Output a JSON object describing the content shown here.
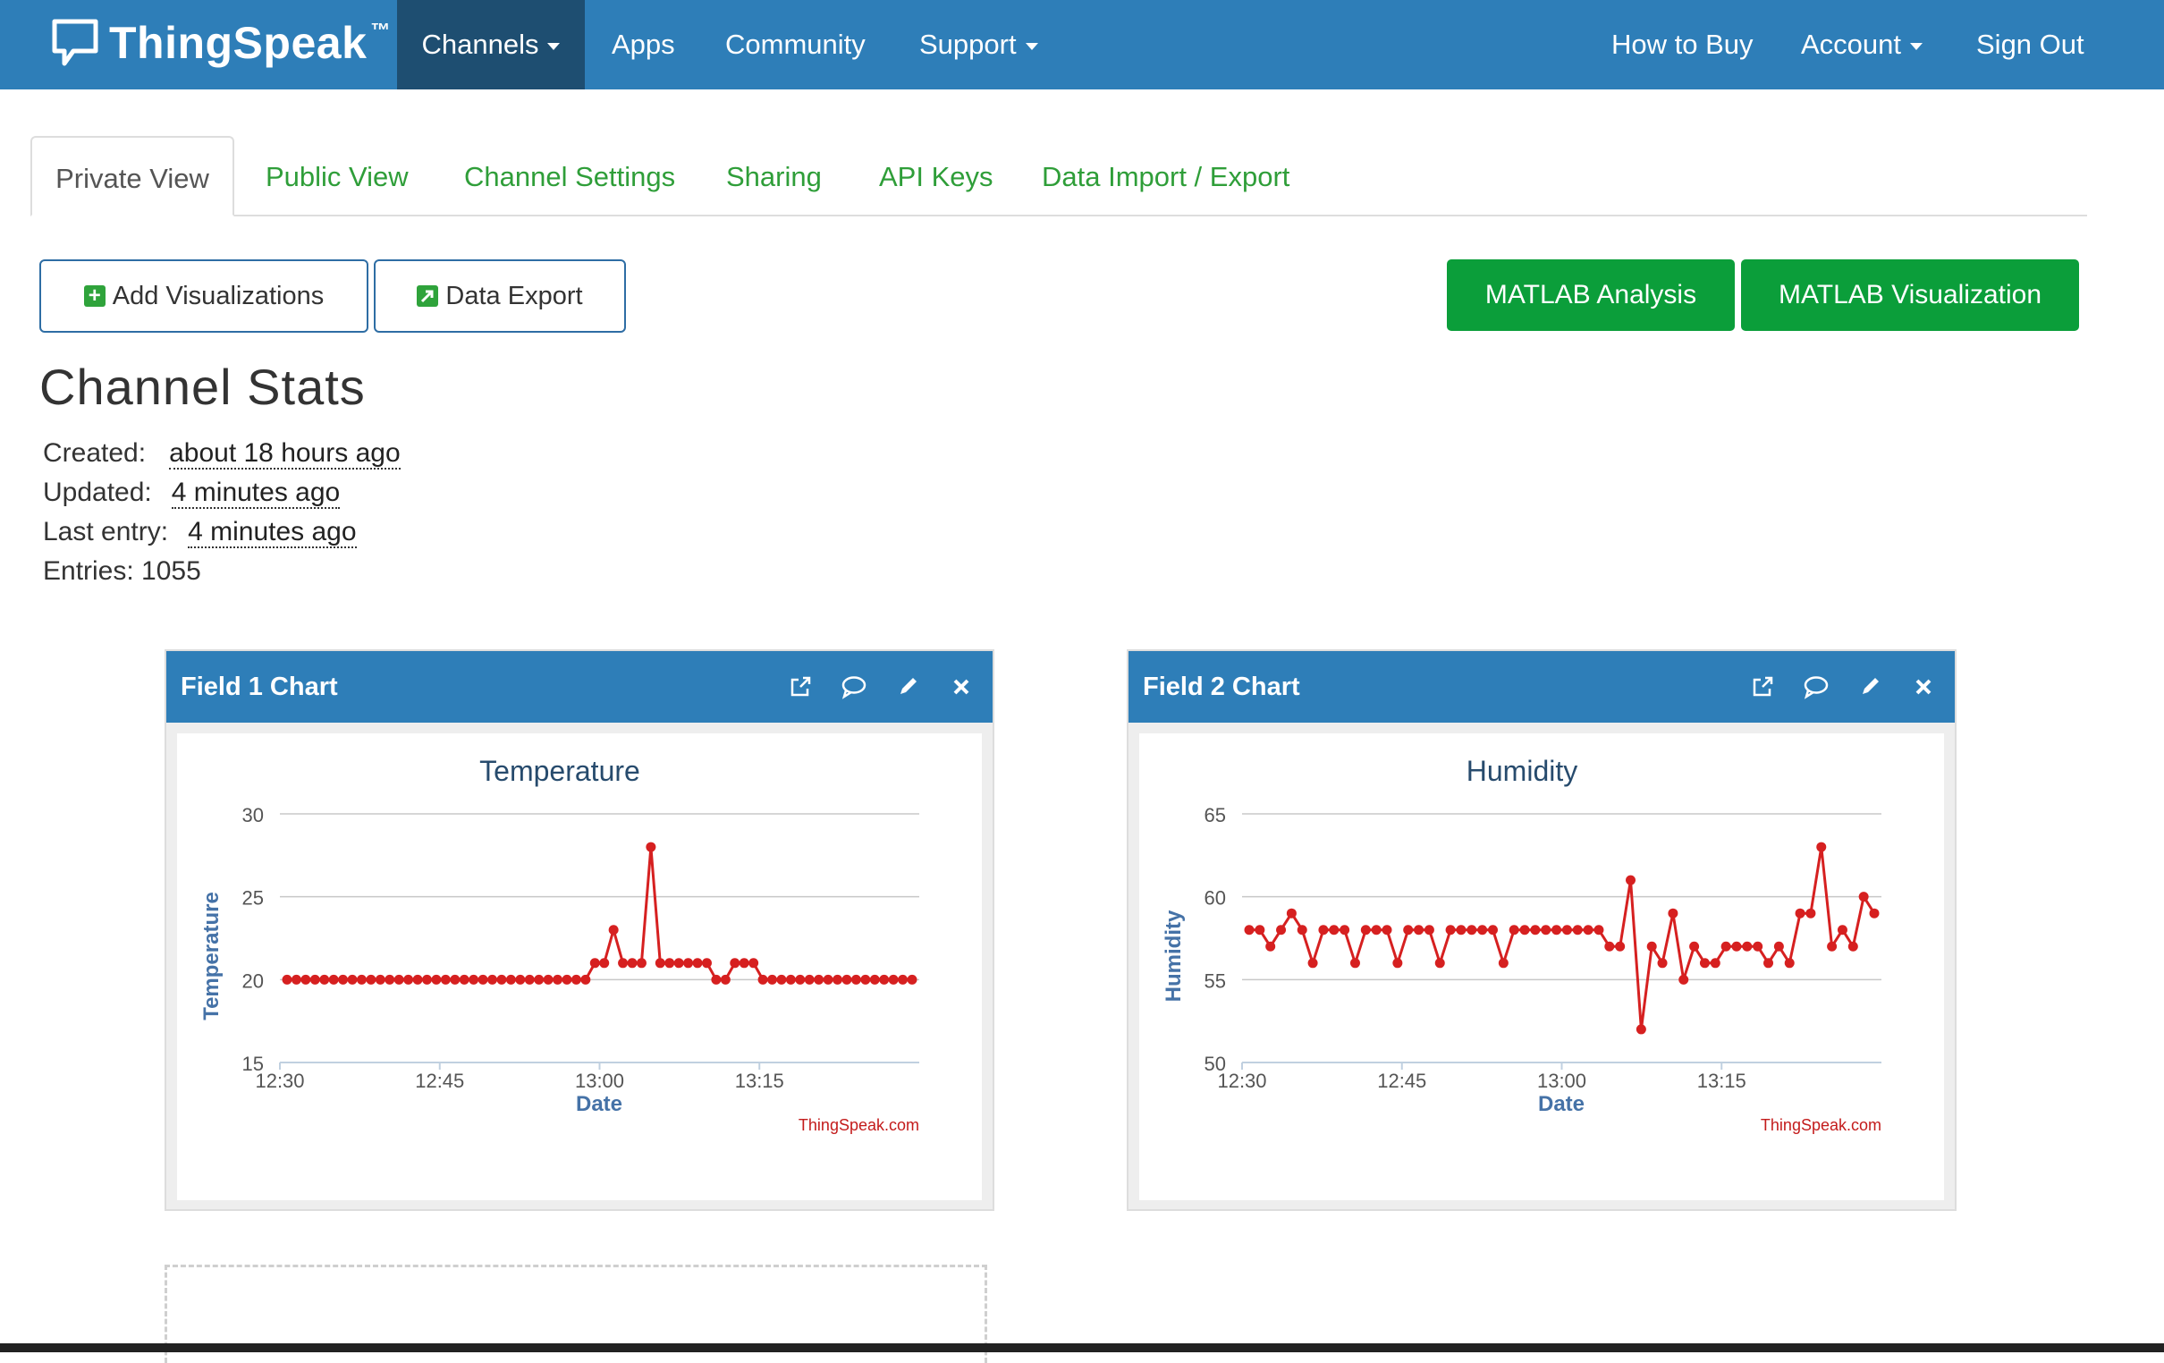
{
  "navbar": {
    "brand": "ThingSpeak",
    "brand_tm": "™",
    "items": [
      {
        "label": "Channels",
        "dropdown": true,
        "active": true
      },
      {
        "label": "Apps"
      },
      {
        "label": "Community"
      },
      {
        "label": "Support",
        "dropdown": true
      }
    ],
    "right_items": [
      {
        "label": "How to Buy"
      },
      {
        "label": "Account",
        "dropdown": true
      },
      {
        "label": "Sign Out"
      }
    ]
  },
  "tabs": [
    {
      "label": "Private View",
      "active": true
    },
    {
      "label": "Public View"
    },
    {
      "label": "Channel Settings"
    },
    {
      "label": "Sharing"
    },
    {
      "label": "API Keys"
    },
    {
      "label": "Data Import / Export"
    }
  ],
  "buttons": {
    "add_visualizations": "Add Visualizations",
    "data_export": "Data Export",
    "matlab_analysis": "MATLAB Analysis",
    "matlab_visualization": "MATLAB Visualization"
  },
  "stats": {
    "title": "Channel Stats",
    "created_label": "Created:",
    "created_value": "about 18 hours ago",
    "updated_label": "Updated:",
    "updated_value": "4 minutes ago",
    "last_entry_label": "Last entry:",
    "last_entry_value": "4 minutes ago",
    "entries": "Entries: 1055"
  },
  "icons": [
    "external-link-icon",
    "comment-icon",
    "pencil-icon",
    "close-icon"
  ],
  "colors": {
    "nav": "#2e7eb8",
    "nav_active": "#1e4e71",
    "tab_link": "#2f9e39",
    "matlab_button": "#0b9e3a",
    "series": "#d62020",
    "axis_label": "#4572a7"
  },
  "chart_data": [
    {
      "panel_title": "Field 1 Chart",
      "type": "line",
      "title": "Temperature",
      "xlabel": "Date",
      "ylabel": "Temperature",
      "credit": "ThingSpeak.com",
      "xtick_labels": [
        "12:30",
        "12:45",
        "13:00",
        "13:15"
      ],
      "xtick_minutes": [
        30,
        45,
        60,
        75
      ],
      "yticks": [
        15,
        20,
        25,
        30
      ],
      "ylim": [
        15,
        30
      ],
      "xlim_minutes": [
        30,
        90
      ],
      "x_minutes": [
        30,
        31,
        32,
        33,
        34,
        35,
        36,
        37,
        38,
        39,
        40,
        41,
        42,
        43,
        44,
        45,
        46,
        47,
        48,
        49,
        50,
        51,
        52,
        53,
        54,
        55,
        56,
        57,
        58,
        59,
        60,
        61,
        62,
        63,
        64,
        65,
        66,
        67,
        68,
        69,
        70,
        71,
        72,
        73,
        74,
        75,
        76,
        77,
        78,
        79,
        80,
        81,
        82,
        83,
        84,
        85
      ],
      "values": [
        20,
        20,
        20,
        20,
        20,
        20,
        20,
        20,
        20,
        20,
        20,
        20,
        20,
        20,
        20,
        20,
        20,
        20,
        20,
        20,
        20,
        20,
        20,
        20,
        20,
        20,
        20,
        20,
        20,
        20,
        20,
        20,
        20,
        21,
        21,
        23,
        21,
        21,
        21,
        28,
        21,
        21,
        21,
        21,
        21,
        21,
        20,
        20,
        21,
        21,
        21,
        20,
        20,
        20,
        20,
        20,
        20,
        20,
        20,
        20,
        20,
        20,
        20,
        20,
        20,
        20,
        20,
        20
      ],
      "grid": true,
      "legend": "none"
    },
    {
      "panel_title": "Field 2 Chart",
      "type": "line",
      "title": "Humidity",
      "xlabel": "Date",
      "ylabel": "Humidity",
      "credit": "ThingSpeak.com",
      "xtick_labels": [
        "12:30",
        "12:45",
        "13:00",
        "13:15"
      ],
      "xtick_minutes": [
        30,
        45,
        60,
        75
      ],
      "yticks": [
        50,
        55,
        60,
        65
      ],
      "ylim": [
        50,
        65
      ],
      "xlim_minutes": [
        30,
        90
      ],
      "x_minutes": [
        30,
        31,
        32,
        33,
        34,
        35,
        36,
        37,
        38,
        39,
        40,
        41,
        42,
        43,
        44,
        45,
        46,
        47,
        48,
        49,
        50,
        51,
        52,
        53,
        54,
        55,
        56,
        57,
        58,
        59,
        60,
        61,
        62,
        63,
        64,
        65,
        66,
        67,
        68,
        69,
        70,
        71,
        72,
        73,
        74,
        75,
        76,
        77,
        78,
        79,
        80,
        81,
        82,
        83,
        84,
        85
      ],
      "values": [
        58,
        58,
        57,
        58,
        59,
        58,
        56,
        58,
        58,
        58,
        56,
        58,
        58,
        58,
        56,
        58,
        58,
        58,
        56,
        58,
        58,
        58,
        58,
        58,
        56,
        58,
        58,
        58,
        58,
        58,
        58,
        58,
        58,
        58,
        57,
        57,
        61,
        52,
        57,
        56,
        59,
        55,
        57,
        56,
        56,
        57,
        57,
        57,
        57,
        56,
        57,
        56,
        59,
        59,
        63,
        57,
        58,
        57,
        60,
        59
      ],
      "grid": true,
      "legend": "none"
    }
  ]
}
